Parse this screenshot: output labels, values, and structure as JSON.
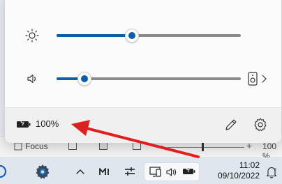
{
  "quick_settings": {
    "brightness_level": 0.41,
    "volume_level": 0.15,
    "battery_label": "100%"
  },
  "word_status": {
    "focus_label": "Focus",
    "zoom_label": "100 %"
  },
  "taskbar": {
    "time": "11:02",
    "date": "09/10/2022"
  },
  "icons": [
    "brightness-icon",
    "speaker-icon",
    "audio-output-icon",
    "chevron-right-icon",
    "battery-icon",
    "edit-icon",
    "settings-icon",
    "start-icon",
    "gear-app-icon",
    "chevron-up-icon",
    "media-icon",
    "sliders-icon",
    "network-icon",
    "volume-icon",
    "battery-tray-icon",
    "notification-icon"
  ],
  "colors": {
    "accent": "#0b5ea8",
    "annotation": "#e02020"
  }
}
